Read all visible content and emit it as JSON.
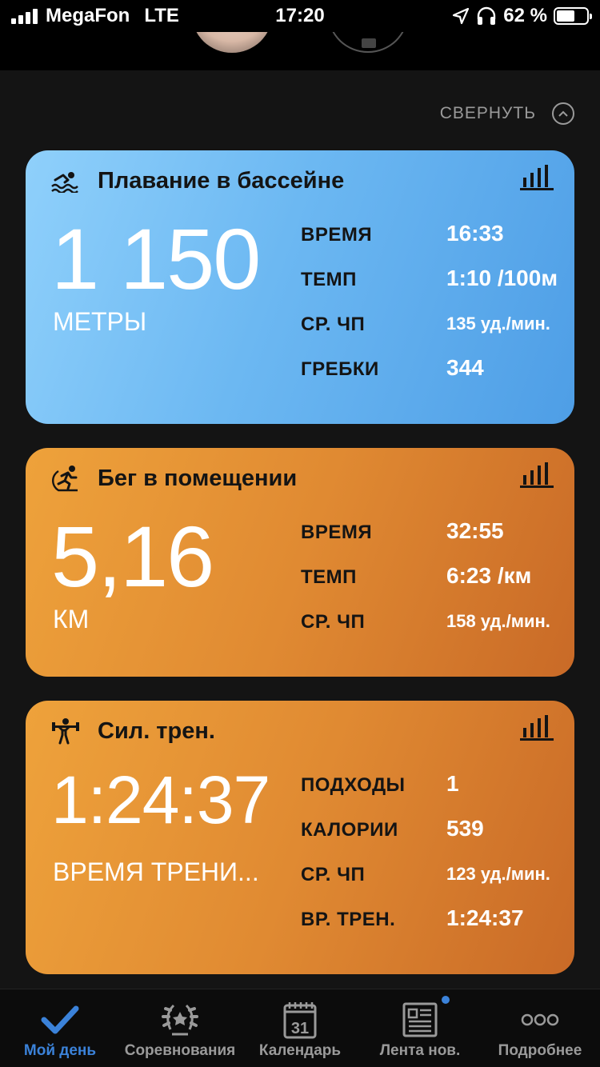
{
  "status_bar": {
    "carrier": "MegaFon",
    "network": "LTE",
    "time": "17:20",
    "battery": "62 %"
  },
  "header": {
    "collapse_label": "СВЕРНУТЬ"
  },
  "activities": {
    "swim": {
      "title": "Плавание в бассейне",
      "value": "1 150",
      "unit": "МЕТРЫ",
      "metrics": [
        {
          "label": "ВРЕМЯ",
          "value": "16:33"
        },
        {
          "label": "ТЕМП",
          "value": "1:10 /100м"
        },
        {
          "label": "СР. ЧП",
          "value": "135 уд./мин."
        },
        {
          "label": "ГРЕБКИ",
          "value": "344"
        }
      ]
    },
    "run": {
      "title": "Бег в помещении",
      "value": "5,16",
      "unit": "КМ",
      "metrics": [
        {
          "label": "ВРЕМЯ",
          "value": "32:55"
        },
        {
          "label": "ТЕМП",
          "value": "6:23 /км"
        },
        {
          "label": "СР. ЧП",
          "value": "158 уд./мин."
        }
      ]
    },
    "strength": {
      "title": "Сил. трен.",
      "value": "1:24:37",
      "unit": "ВРЕМЯ ТРЕНИ...",
      "metrics": [
        {
          "label": "ПОДХОДЫ",
          "value": "1"
        },
        {
          "label": "КАЛОРИИ",
          "value": "539"
        },
        {
          "label": "СР. ЧП",
          "value": "123 уд./мин."
        },
        {
          "label": "ВР. ТРЕН.",
          "value": "1:24:37"
        }
      ]
    }
  },
  "tabbar": {
    "items": [
      {
        "label": "Мой день",
        "icon": "checkmark-icon",
        "active": true
      },
      {
        "label": "Соревнования",
        "icon": "laurel-icon"
      },
      {
        "label": "Календарь",
        "icon": "calendar-icon",
        "badge_text": "31"
      },
      {
        "label": "Лента нов.",
        "icon": "newsfeed-icon",
        "has_dot": true
      },
      {
        "label": "Подробнее",
        "icon": "more-icon"
      }
    ]
  },
  "colors": {
    "accent": "#3b82d9",
    "swim_card": "#6cb8f2",
    "activity_card": "#e08a32"
  }
}
